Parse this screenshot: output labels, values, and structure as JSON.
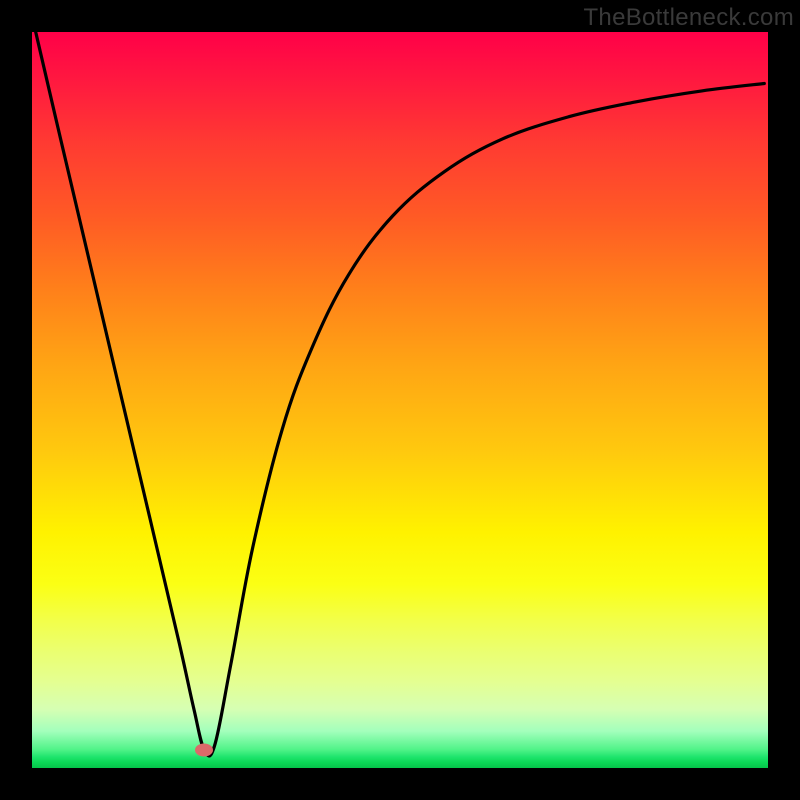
{
  "watermark": "TheBottleneck.com",
  "chart_data": {
    "type": "line",
    "title": "",
    "xlabel": "",
    "ylabel": "",
    "xlim": [
      0,
      100
    ],
    "ylim": [
      0,
      100
    ],
    "series": [
      {
        "name": "bottleneck-curve",
        "x": [
          0.5,
          4,
          8,
          12,
          16,
          20,
          22,
          23.4,
          24.8,
          27,
          30,
          34,
          38,
          43,
          49,
          56,
          64,
          73,
          82,
          91,
          99.5
        ],
        "y": [
          100,
          85,
          68,
          51,
          34,
          17,
          8,
          2.5,
          3,
          14,
          30,
          46,
          57,
          67,
          75,
          81,
          85.5,
          88.5,
          90.5,
          92,
          93
        ]
      }
    ],
    "annotations": [
      {
        "name": "optimal-point",
        "x": 23.4,
        "y": 2.5
      }
    ],
    "gradient_stops": [
      {
        "pct": 0,
        "color": "#ff0048"
      },
      {
        "pct": 50,
        "color": "#ffb010"
      },
      {
        "pct": 70,
        "color": "#fff200"
      },
      {
        "pct": 100,
        "color": "#05c44a"
      }
    ]
  }
}
